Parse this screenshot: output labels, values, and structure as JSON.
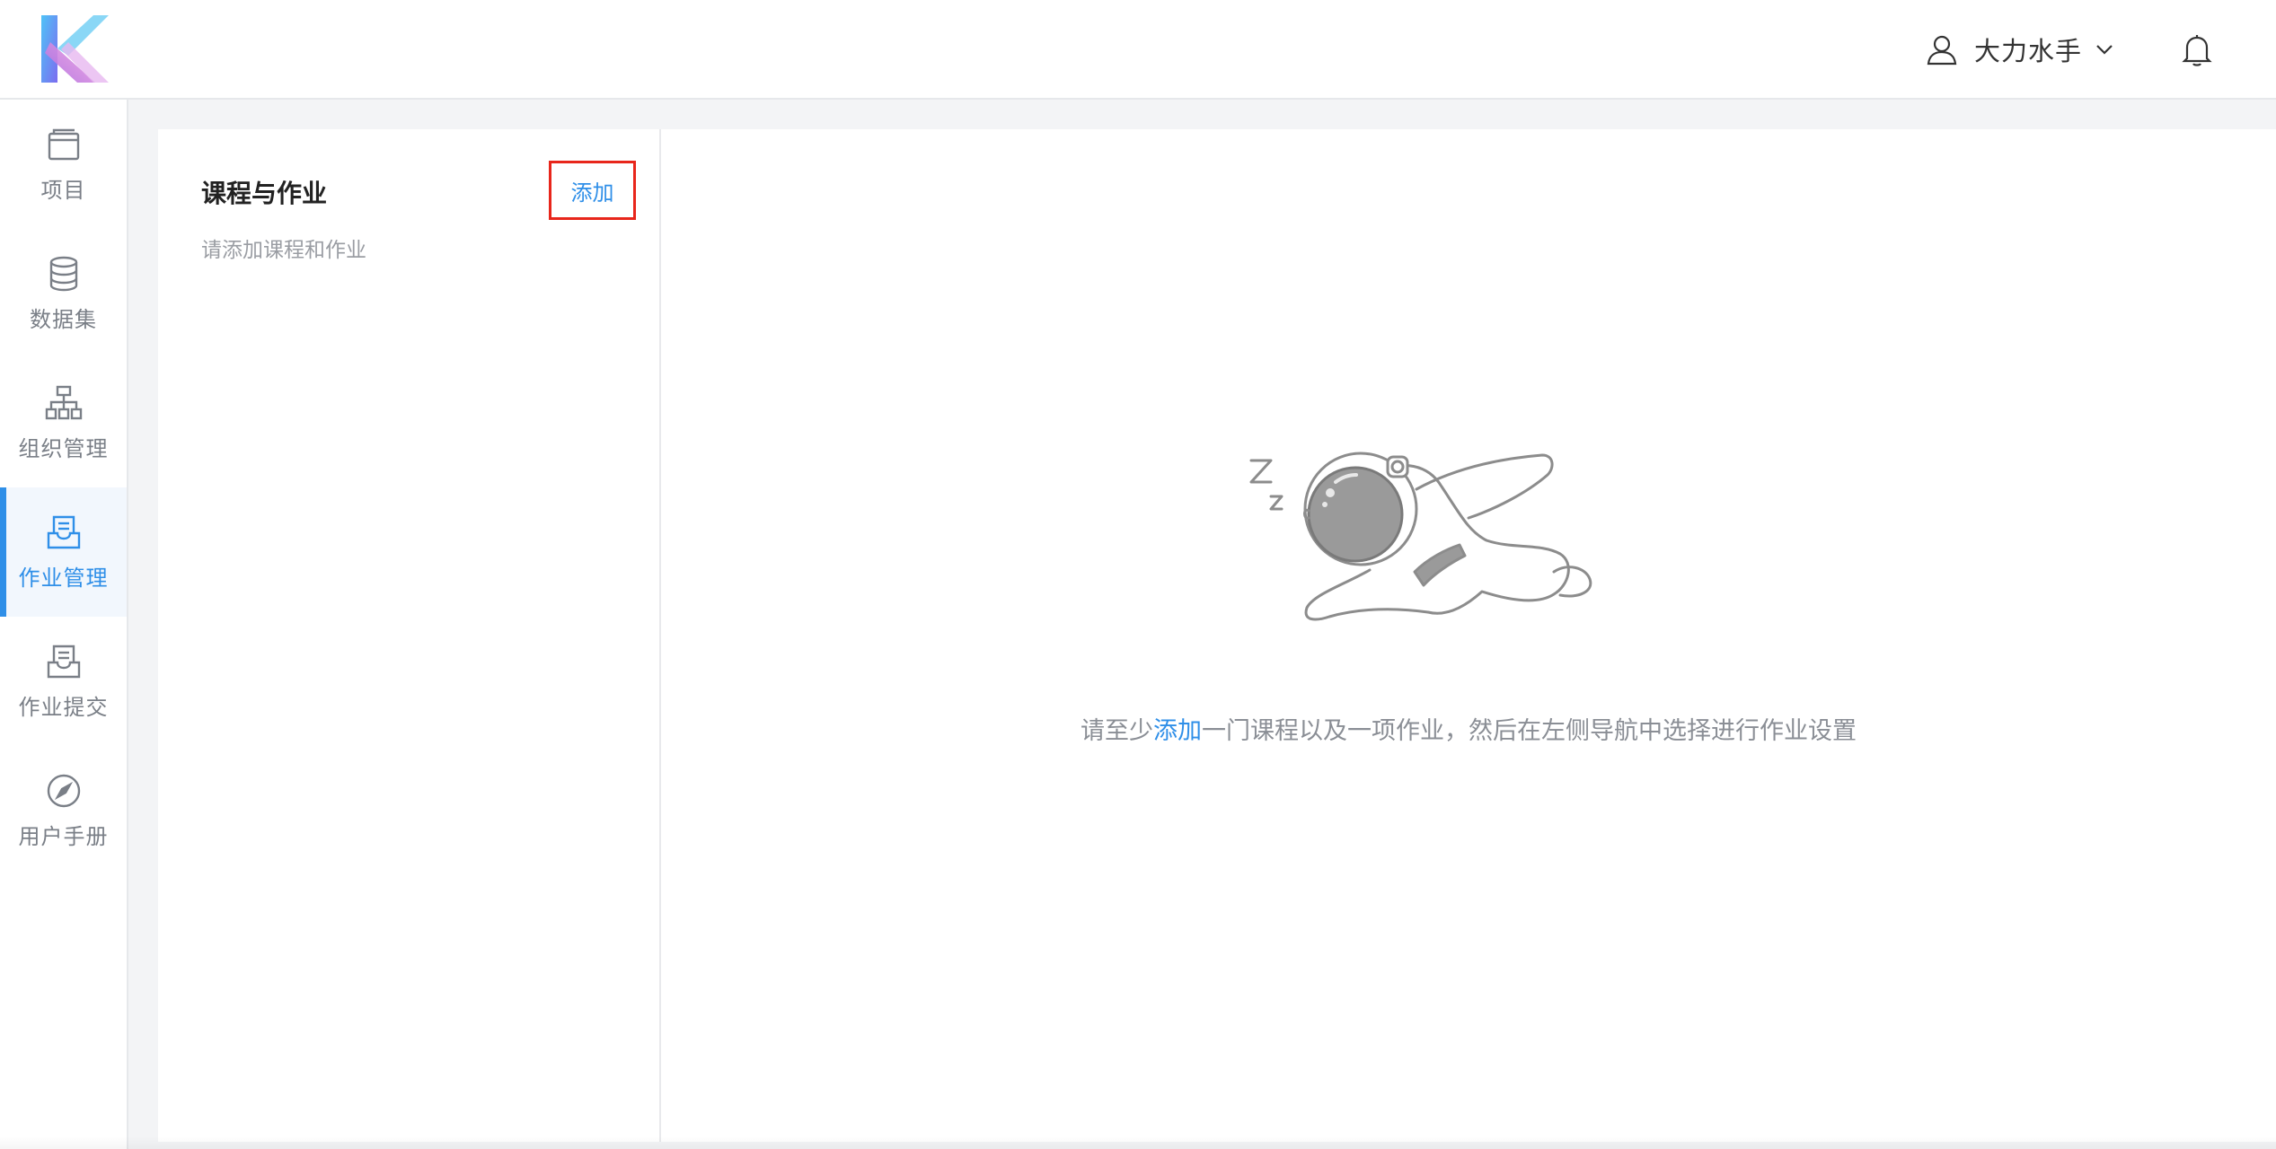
{
  "header": {
    "user_name": "大力水手",
    "icons": {
      "logo": "brand-logo",
      "user": "user-icon",
      "dropdown": "chevron-down-icon",
      "notifications": "bell-icon"
    }
  },
  "sidebar": {
    "items": [
      {
        "label": "项目",
        "icon": "window-icon",
        "active": false
      },
      {
        "label": "数据集",
        "icon": "database-icon",
        "active": false
      },
      {
        "label": "组织管理",
        "icon": "org-chart-icon",
        "active": false
      },
      {
        "label": "作业管理",
        "icon": "tray-document-icon",
        "active": true
      },
      {
        "label": "作业提交",
        "icon": "tray-document-icon",
        "active": false
      },
      {
        "label": "用户手册",
        "icon": "compass-icon",
        "active": false
      }
    ]
  },
  "left_panel": {
    "title": "课程与作业",
    "add_label": "添加",
    "hint": "请添加课程和作业"
  },
  "empty_state": {
    "illustration": "sleeping-astronaut",
    "text_before": "请至少",
    "link": "添加",
    "text_after": "一门课程以及一项作业，然后在左侧导航中选择进行作业设置"
  },
  "colors": {
    "accent": "#2f8fe8",
    "highlight_border": "#e8261b",
    "background": "#f3f4f6",
    "muted_text": "#8a8e95"
  }
}
